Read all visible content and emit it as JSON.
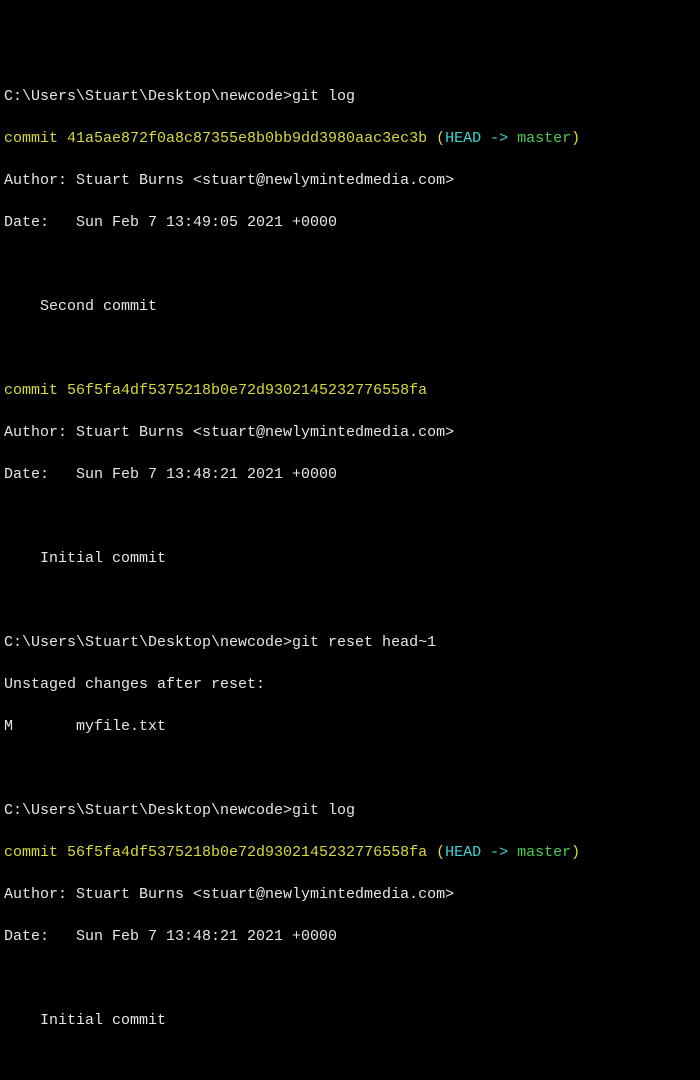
{
  "prompt_path": "C:\\Users\\Stuart\\Desktop\\newcode>",
  "commands": {
    "git_log": "git log",
    "git_reset": "git reset head~1"
  },
  "commits": {
    "c1": {
      "prefix": "commit ",
      "hash": "41a5ae872f0a8c87355e8b0bb9dd3980aac3ec3b",
      "head_open": " (",
      "head_label": "HEAD -> ",
      "head_branch": "master",
      "head_close": ")",
      "author_line": "Author: Stuart Burns <stuart@newlymintedmedia.com>",
      "date_line": "Date:   Sun Feb 7 13:49:05 2021 +0000",
      "message": "    Second commit"
    },
    "c2": {
      "prefix": "commit ",
      "hash": "56f5fa4df5375218b0e72d9302145232776558fa",
      "author_line": "Author: Stuart Burns <stuart@newlymintedmedia.com>",
      "date_line": "Date:   Sun Feb 7 13:48:21 2021 +0000",
      "message": "    Initial commit"
    }
  },
  "reset_output": {
    "line1": "Unstaged changes after reset:",
    "line2": "M       myfile.txt"
  }
}
